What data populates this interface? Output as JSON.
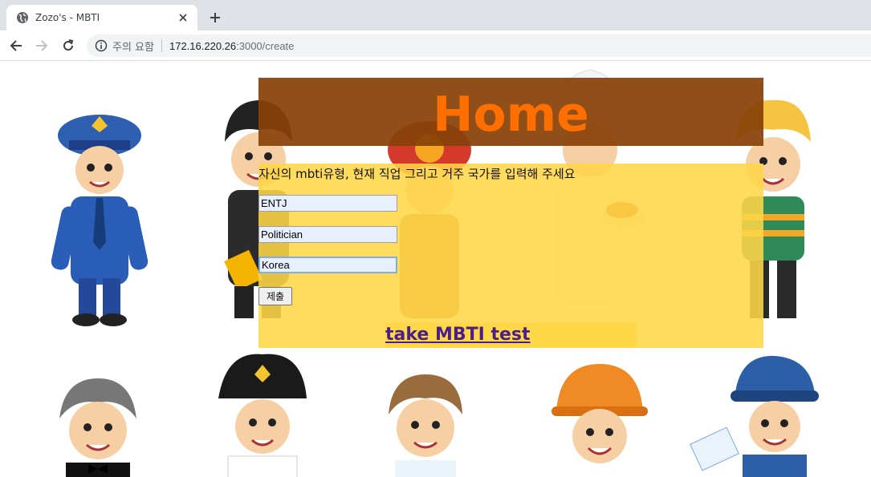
{
  "browser": {
    "tab_title": "Zozo's - MBTI",
    "security_label": "주의 요함",
    "url_host": "172.16.220.26",
    "url_path": ":3000/create"
  },
  "page": {
    "banner_title": "Home",
    "instruction": "자신의 mbti유형, 현재 직업 그리고 거주 국가를 입력해 주세요",
    "fields": [
      {
        "value": "ENTJ"
      },
      {
        "value": "Politician"
      },
      {
        "value": "Korea"
      }
    ],
    "submit_label": "제출",
    "test_link": "take MBTI test"
  },
  "colors": {
    "banner_bg": "#884208",
    "banner_text": "#ff6f00",
    "panel_bg": "#ffd648",
    "link": "#4b1f8a"
  }
}
